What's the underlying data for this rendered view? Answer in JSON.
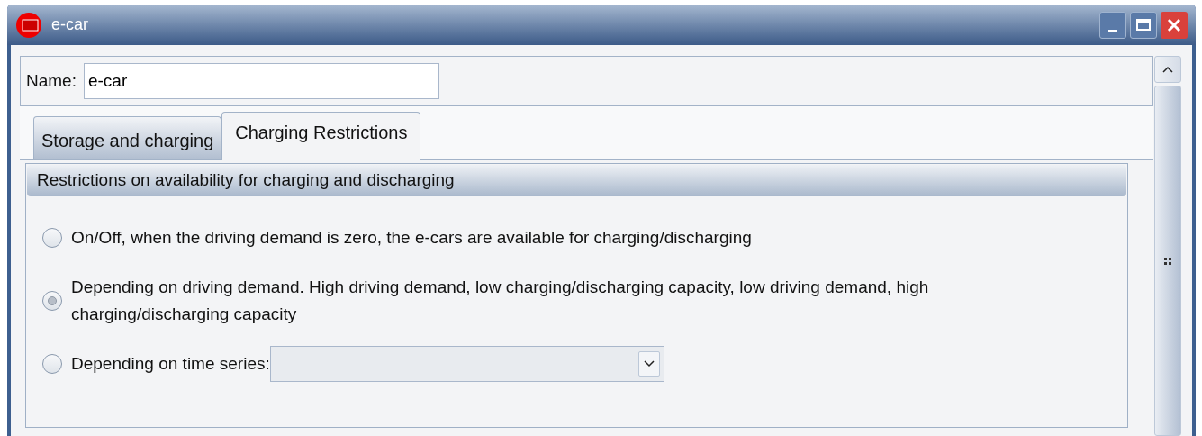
{
  "window": {
    "title": "e-car"
  },
  "name_field": {
    "label": "Name:",
    "value": "e-car"
  },
  "tabs": [
    {
      "label": "Storage and charging",
      "selected": false
    },
    {
      "label": "Charging Restrictions",
      "selected": true
    }
  ],
  "group": {
    "title": "Restrictions on availability for charging and discharging",
    "options": [
      {
        "label": "On/Off, when the driving demand is zero, the e-cars are available for charging/discharging",
        "selected": false
      },
      {
        "label": "Depending on driving demand. High driving demand, low charging/discharging capacity, low driving demand, high charging/discharging capacity",
        "selected": true
      },
      {
        "label": "Depending on time series:",
        "selected": false,
        "kind": "dropdown"
      }
    ]
  }
}
